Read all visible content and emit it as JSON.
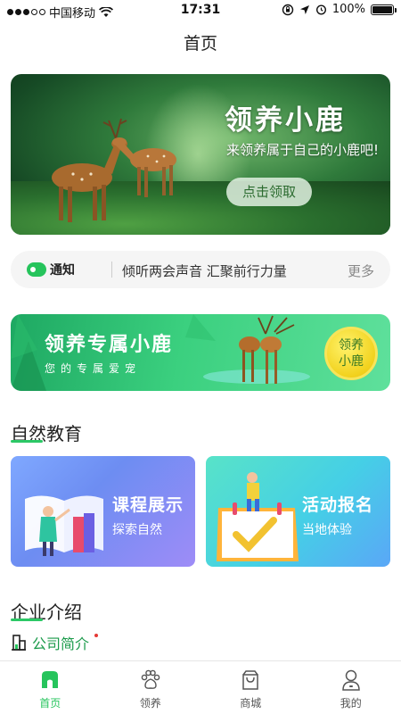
{
  "status_bar": {
    "carrier": "中国移动",
    "time": "17:31",
    "battery": "100%",
    "battery_level": 1.0
  },
  "nav": {
    "title": "首页"
  },
  "hero": {
    "title": "领养小鹿",
    "subtitle": "来领养属于自己的小鹿吧!",
    "button": "点击领取"
  },
  "notice": {
    "logo_text": "通知",
    "text": "倾听两会声音 汇聚前行力量",
    "more": "更多"
  },
  "promo": {
    "title": "领养专属小鹿",
    "subtitle": "您的专属爱宠",
    "badge_line1": "领养",
    "badge_line2": "小鹿"
  },
  "nature_education": {
    "title": "自然教育",
    "cards": [
      {
        "title": "课程展示",
        "subtitle": "探索自然"
      },
      {
        "title": "活动报名",
        "subtitle": "当地体验"
      }
    ]
  },
  "company": {
    "title": "企业介绍",
    "intro_label": "公司简介"
  },
  "tabs": [
    {
      "label": "首页",
      "icon": "home-icon",
      "active": true
    },
    {
      "label": "领养",
      "icon": "paw-icon",
      "active": false
    },
    {
      "label": "商城",
      "icon": "shopping-bag-icon",
      "active": false
    },
    {
      "label": "我的",
      "icon": "user-icon",
      "active": false
    }
  ],
  "colors": {
    "accent": "#26c45c",
    "notice_bg": "#f5f5f5",
    "badge_yellow": "#f2d21e"
  }
}
